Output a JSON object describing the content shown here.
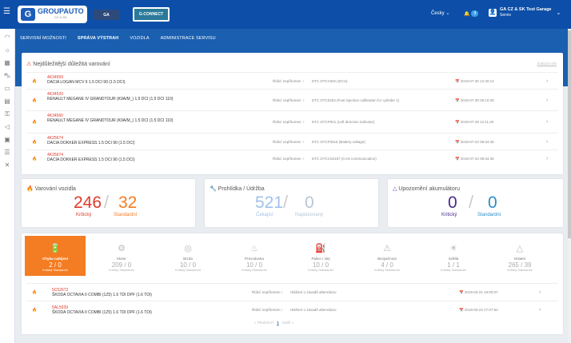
{
  "topbar": {
    "menu_icon": "☰",
    "logo_main": "GROUPAUTO",
    "logo_sub": "CZ & SK",
    "logo2": "GA",
    "logo3": "G-CONNECT",
    "language": "Česky",
    "notif_count": "9",
    "user_name": "GA CZ & SK Test Garage",
    "user_role": "Servis"
  },
  "sidebar": {
    "icons": [
      "gauge-icon",
      "sun-icon",
      "calendar-icon",
      "car-icon",
      "battery-icon",
      "bulb-icon",
      "key-icon",
      "megaphone-icon",
      "cart-icon",
      "list-icon",
      "tools-icon"
    ]
  },
  "subnav": {
    "items": [
      "SERVISNÍ MOŽNOSTI",
      "SPRÁVA VÝSTRAH",
      "VOZIDLA",
      "ADMINISTRACE SERVISU"
    ]
  },
  "warnings": {
    "title": "Nejdůležitější důležitá varování",
    "show_all": "Zobrazit vše",
    "rows": [
      {
        "id": "4K34559",
        "car": "DACIA LOGAN MCV II 1.5 DCI 90 (1.5 DCI)",
        "category": "Řídicí nepřítomen",
        "sep": "/",
        "dtc": "DTC DTCC60A (ECU)",
        "date": "2019-07-30 12:40:14"
      },
      {
        "id": "4K34520",
        "car": "RENAULT MEGANE IV GRANDTOUR (K9A/M_) 1.5 DCI (1.5 DCI 110)",
        "category": "Řídicí nepřítomen",
        "sep": "/",
        "dtc": "DTC DTC0263 (Fuel injection calibration for cylinder 1)",
        "date": "2019-07-30 05:10:39"
      },
      {
        "id": "4K34560",
        "car": "RENAULT MEGANE IV GRANDTOUR (K9A/M_) 1.5 DCI (1.5 DCI 110)",
        "category": "Řídicí nepřítomen",
        "sep": "/",
        "dtc": "DTC DTCP501 (Left direction indicator)",
        "date": "2019-07-29 12:11:20"
      },
      {
        "id": "4K25674",
        "car": "DACIA DOKKER EXPRESS 1.5 DCI 90 (1.5 DCI)",
        "category": "Řídicí nepřítomen",
        "sep": "/",
        "dtc": "DTC DTCF0516 (Battery voltage)",
        "date": "2019-07-22 08:34:36"
      },
      {
        "id": "4K25674",
        "car": "DACIA DOKKER EXPRESS 1.5 DCI 90 (1.5 DCI)",
        "category": "Řídicí nepřítomen",
        "sep": "/",
        "dtc": "DTC DTCC00187 (CAN communication)",
        "date": "2019-07-22 08:34:36"
      }
    ]
  },
  "stats": [
    {
      "title": "Varování vozidla",
      "a": "246",
      "a_label": "Kritický",
      "b": "32",
      "b_label": "Standardní"
    },
    {
      "title": "Prohlídka / Údržba",
      "a": "521",
      "a_label": "Čekající",
      "b": "0",
      "b_label": "Naplánovaný"
    },
    {
      "title": "Upozornění akumulátoru",
      "a": "0",
      "a_label": "Kritický",
      "b": "0",
      "b_label": "Standardní"
    }
  ],
  "categories": {
    "tabs": [
      {
        "icon": "🔋",
        "name": "Chyba nabíjení",
        "a": "2",
        "b": "0"
      },
      {
        "icon": "⚙",
        "name": "Motor",
        "a": "209",
        "b": "0"
      },
      {
        "icon": "◎",
        "name": "Brzda",
        "a": "10",
        "b": "0"
      },
      {
        "icon": "♨",
        "name": "Prevodovka",
        "a": "10",
        "b": "0"
      },
      {
        "icon": "⛽",
        "name": "Palivo / olej",
        "a": "10",
        "b": "0"
      },
      {
        "icon": "⚠",
        "name": "Bezpečnost",
        "a": "4",
        "b": "0"
      },
      {
        "icon": "☀",
        "name": "Světla",
        "a": "1",
        "b": "1"
      },
      {
        "icon": "△",
        "name": "Ostatní",
        "a": "265",
        "b": "39"
      }
    ],
    "sub_a": "Kritický",
    "sub_b": "Standardní",
    "slash": "/",
    "rows": [
      {
        "id": "5C52672",
        "car": "ŠKODA OCTAVIA II COMBI (1Z5) 1.6 TDI DPF (1.6 TDI)",
        "category": "Řídicí nepřítomen",
        "sep": "/",
        "dtc": "Hlášení o závadě alternátoru",
        "date": "2019-03-21 19:00:07"
      },
      {
        "id": "5AL5939",
        "car": "ŠKODA OCTAVIA II COMBI (1Z5) 1.6 TDI DPF (1.6 TDI)",
        "category": "Řídicí nepřítomen",
        "sep": "/",
        "dtc": "Hlášení o závadě alternátoru",
        "date": "2019-03-22 17:07:52"
      }
    ],
    "pager": {
      "prev": "« Předchozí",
      "page": "1",
      "next": "Další »"
    }
  }
}
